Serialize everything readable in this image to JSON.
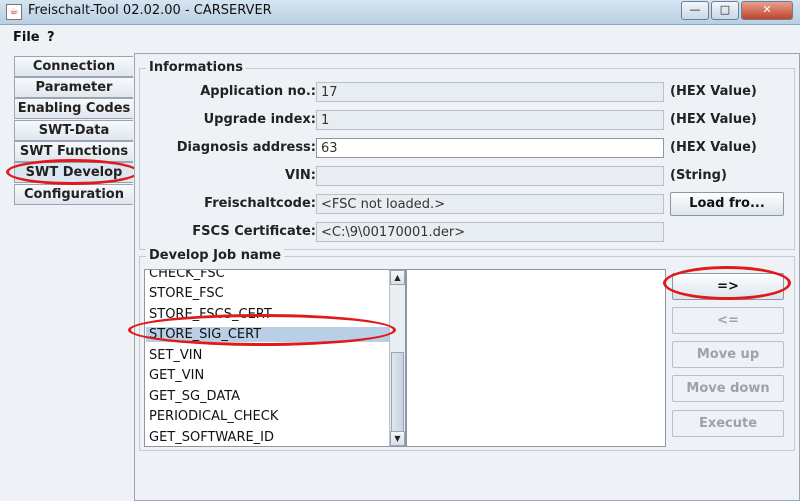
{
  "window": {
    "title": "Freischalt-Tool 02.02.00 - CARSERVER",
    "app_icon": "java-icon"
  },
  "menu": {
    "items": [
      "File",
      "?"
    ]
  },
  "tabs": [
    "Connection",
    "Parameter",
    "Enabling Codes",
    "SWT-Data",
    "SWT Functions",
    "SWT Develop",
    "Configuration"
  ],
  "selected_tab": "SWT Develop",
  "informations": {
    "title": "Informations",
    "fields": [
      {
        "label": "Application no.:",
        "value": "17",
        "suffix": "(HEX Value)",
        "editable": false
      },
      {
        "label": "Upgrade index:",
        "value": "1",
        "suffix": "(HEX Value)",
        "editable": false
      },
      {
        "label": "Diagnosis address:",
        "value": "63",
        "suffix": "(HEX Value)",
        "editable": true
      },
      {
        "label": "VIN:",
        "value": "",
        "suffix": "(String)",
        "editable": false
      },
      {
        "label": "Freischaltcode:",
        "value": "<FSC not loaded.>",
        "suffix": "",
        "editable": false
      },
      {
        "label": "FSCS Certificate:",
        "value": "<C:\\9\\00170001.der>",
        "suffix": "",
        "editable": false
      }
    ],
    "load_button": "Load fro..."
  },
  "develop": {
    "title": "Develop Job name",
    "jobs": [
      "CHECK_FSC",
      "STORE_FSC",
      "STORE_FSCS_CERT",
      "STORE_SIG_CERT",
      "SET_VIN",
      "GET_VIN",
      "GET_SG_DATA",
      "PERIODICAL_CHECK",
      "GET_SOFTWARE_ID"
    ],
    "selected_job": "STORE_SIG_CERT",
    "buttons": {
      "add": "=>",
      "remove": "<=",
      "move_up": "Move up",
      "move_down": "Move down",
      "execute": "Execute"
    }
  },
  "annotation_color": "#e01a1a"
}
